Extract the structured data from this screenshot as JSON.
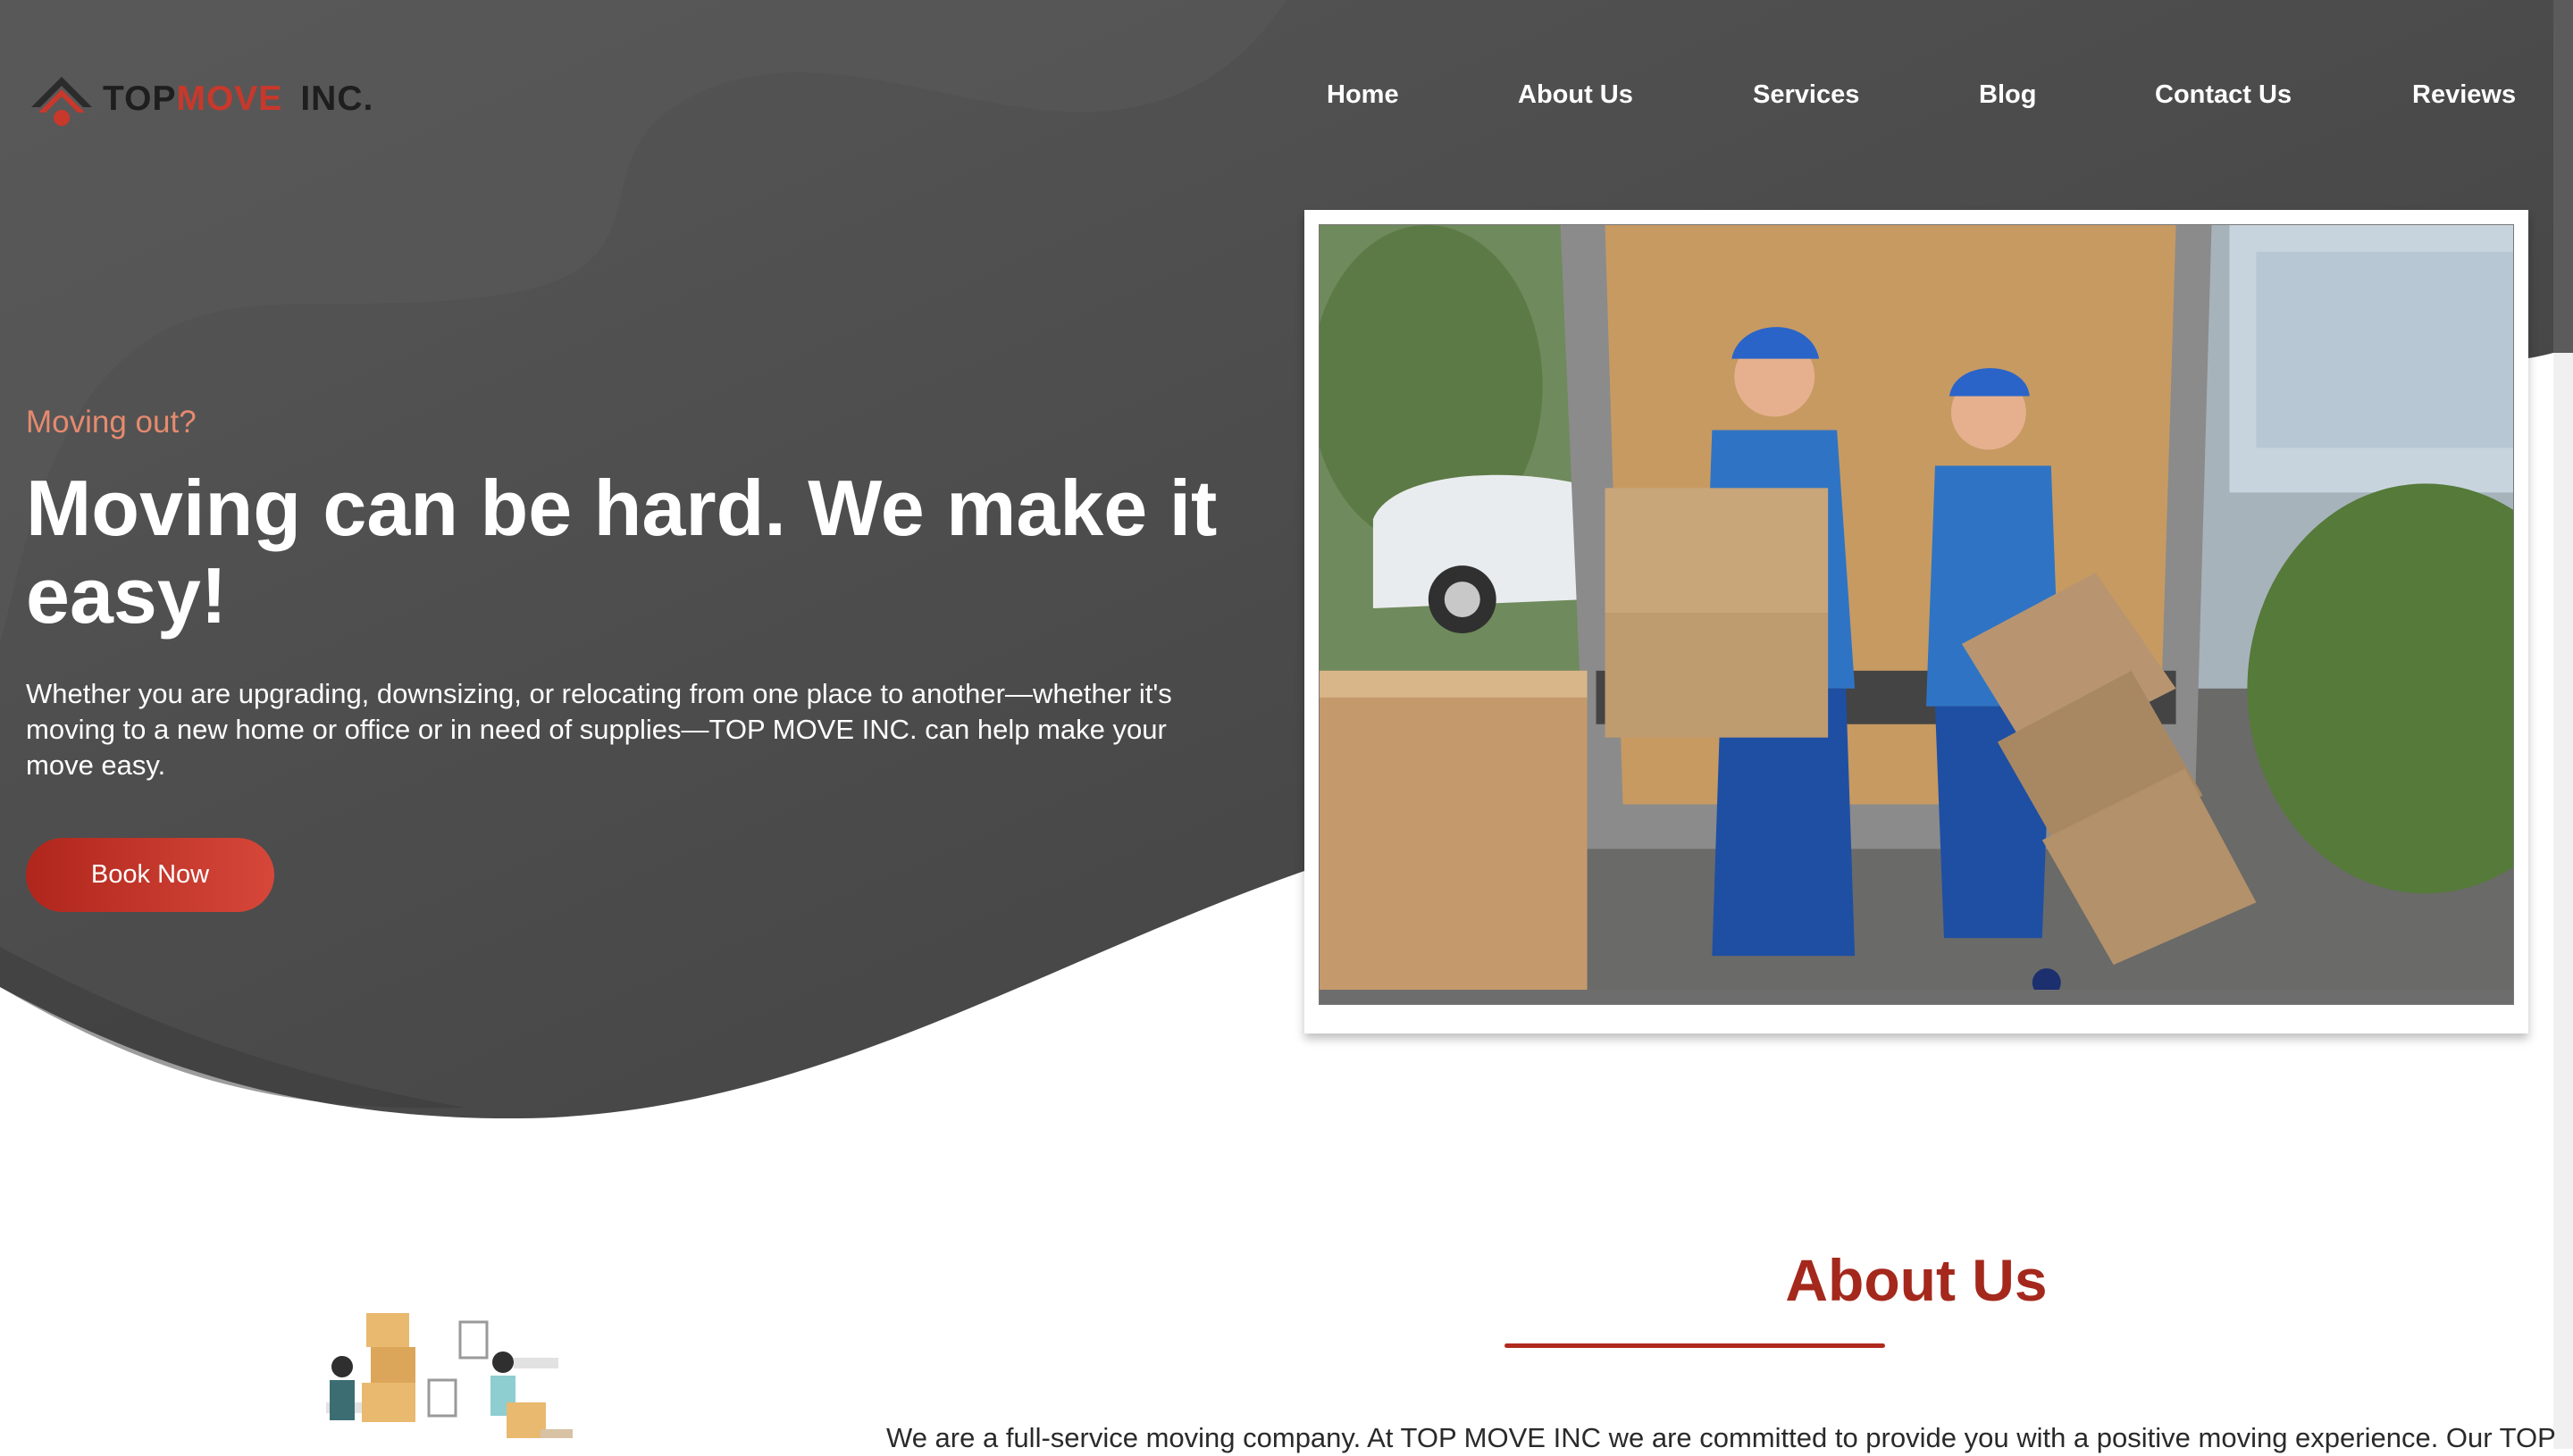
{
  "header": {
    "logo": {
      "top": "TOP",
      "move": "MOVE",
      "inc": "INC."
    },
    "nav": [
      {
        "label": "Home"
      },
      {
        "label": "About Us"
      },
      {
        "label": "Services"
      },
      {
        "label": "Blog"
      },
      {
        "label": "Contact Us"
      },
      {
        "label": "Reviews"
      }
    ]
  },
  "hero": {
    "eyebrow": "Moving out?",
    "headline": "Moving can be hard. We make it easy!",
    "body": "Whether you are upgrading, downsizing, or relocating from one place to another—whether it's moving to a new home or office or in need of supplies—TOP MOVE INC. can help make your move easy.",
    "cta_label": "Book Now",
    "image_icon": "movers-with-boxes-photo"
  },
  "about": {
    "title": "About Us",
    "text": "We are a full-service moving company. At TOP MOVE INC we are committed to provide you with a positive moving experience. Our TOP",
    "illustration_icon": "movers-carrying-boxes-illustration"
  },
  "colors": {
    "hero_background": "#4b4b4b",
    "accent_red": "#b02a1e",
    "eyebrow_salmon": "#e58a6f"
  }
}
